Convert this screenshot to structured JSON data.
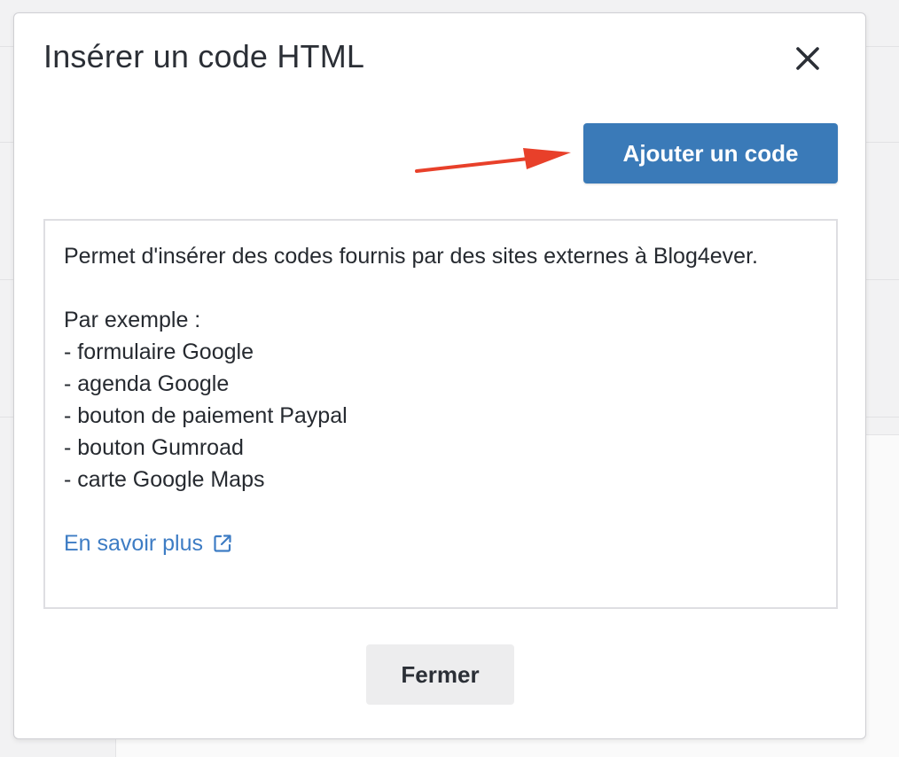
{
  "modal": {
    "title": "Insérer un code HTML",
    "close_icon": "close-icon",
    "add_button_label": "Ajouter un code",
    "annotation": {
      "icon": "red-arrow-icon",
      "color": "#e8402a"
    },
    "info": {
      "intro": "Permet d'insérer des codes fournis par des sites externes à Blog4ever.",
      "example_heading": "Par exemple :",
      "examples": [
        "- formulaire Google",
        "- agenda Google",
        "- bouton de paiement Paypal",
        "- bouton Gumroad",
        "- carte Google Maps"
      ],
      "learn_more_label": "En savoir plus",
      "learn_more_icon": "external-link-icon"
    },
    "footer_button_label": "Fermer"
  },
  "colors": {
    "primary": "#3a7ab8",
    "link": "#3d7cc4",
    "arrow": "#e8402a",
    "secondary_button": "#ededee"
  }
}
